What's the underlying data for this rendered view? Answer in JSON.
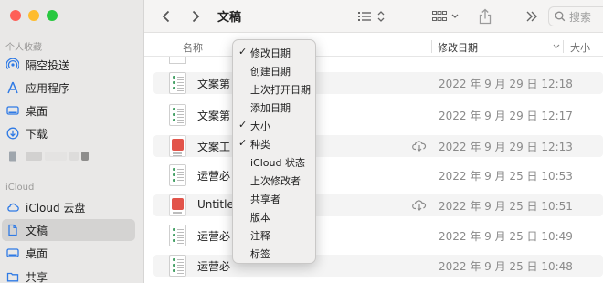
{
  "sidebar": {
    "sections": {
      "favorites": "个人收藏",
      "icloud": "iCloud"
    },
    "items": [
      {
        "label": "隔空投送",
        "icon": "airdrop-icon"
      },
      {
        "label": "应用程序",
        "icon": "applications-icon"
      },
      {
        "label": "桌面",
        "icon": "desktop-icon"
      },
      {
        "label": "下载",
        "icon": "downloads-icon"
      },
      {
        "label": "",
        "icon": "document-icon"
      },
      {
        "label": "iCloud 云盘",
        "icon": "icloud-drive-icon"
      },
      {
        "label": "文稿",
        "icon": "documents-folder-icon",
        "selected": true
      },
      {
        "label": "桌面",
        "icon": "desktop-icon"
      },
      {
        "label": "共享",
        "icon": "shared-folder-icon"
      }
    ]
  },
  "toolbar": {
    "title": "文稿",
    "search_placeholder": "搜索"
  },
  "columns": {
    "name": "名称",
    "date": "修改日期",
    "size": "大小"
  },
  "files": [
    {
      "name": "文案第",
      "date": "2022 年 9 月 29 日 12:18",
      "type": "sheet",
      "cloud": false
    },
    {
      "name": "文案第",
      "date": "2022 年 9 月 29 日 12:17",
      "type": "sheet",
      "cloud": false
    },
    {
      "name": "文案工",
      "date": "2022 年 9 月 29 日 12:13",
      "type": "pdf",
      "cloud": true
    },
    {
      "name": "运营必",
      "date": "2022 年 9 月 25 日 10:53",
      "type": "sheet",
      "cloud": false
    },
    {
      "name": "Untitle",
      "date": "2022 年 9 月 25 日 10:51",
      "type": "pdf",
      "cloud": true
    },
    {
      "name": "运营必",
      "date": "2022 年 9 月 25 日 10:49",
      "type": "sheet",
      "cloud": false
    },
    {
      "name": "运营必",
      "date": "2022 年 9 月 25 日 10:48",
      "type": "sheet",
      "cloud": false
    }
  ],
  "column_menu": {
    "items": [
      {
        "label": "修改日期",
        "checked": true
      },
      {
        "label": "创建日期",
        "checked": false
      },
      {
        "label": "上次打开日期",
        "checked": false
      },
      {
        "label": "添加日期",
        "checked": false
      },
      {
        "label": "大小",
        "checked": true
      },
      {
        "label": "种类",
        "checked": true
      },
      {
        "label": "iCloud 状态",
        "checked": false
      },
      {
        "label": "上次修改者",
        "checked": false
      },
      {
        "label": "共享者",
        "checked": false
      },
      {
        "label": "版本",
        "checked": false
      },
      {
        "label": "注释",
        "checked": false
      },
      {
        "label": "标签",
        "checked": false
      }
    ],
    "check_glyph": "✓"
  },
  "colors": {
    "accent": "#2f7ae5",
    "sidebar_bg": "#e9e8e7",
    "selected_bg": "#d4d3d2",
    "pdf_red": "#e2544a"
  }
}
